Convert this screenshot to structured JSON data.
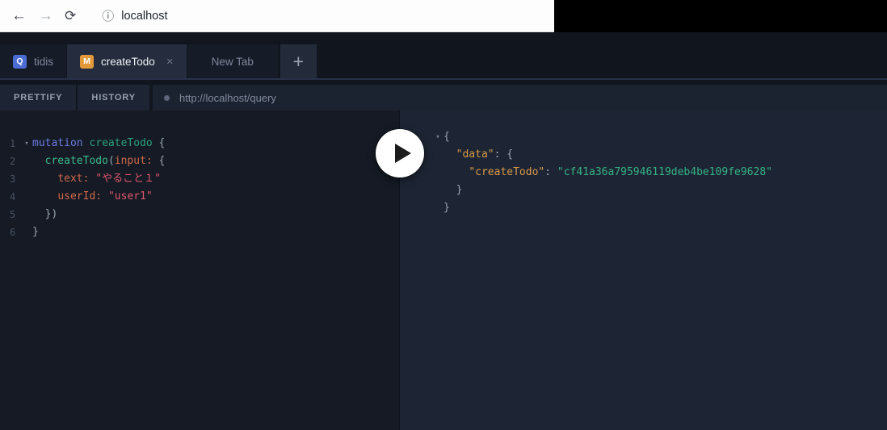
{
  "browser": {
    "address": "localhost"
  },
  "icons": {
    "back": "←",
    "forward": "→",
    "reload": "⟳",
    "info": "ⓘ",
    "close": "×",
    "add_tab": "+",
    "fold": "▾"
  },
  "tabs": {
    "items": [
      {
        "badge": "Q",
        "label": "tidis",
        "active": false
      },
      {
        "badge": "M",
        "label": "createTodo",
        "active": true
      },
      {
        "badge": "",
        "label": "New Tab",
        "active": false
      }
    ]
  },
  "toolbar": {
    "prettify_label": "PRETTIFY",
    "history_label": "HISTORY",
    "endpoint_url": "http://localhost/query"
  },
  "colors": {
    "query_badge": "#4a6cd4",
    "mutation_badge": "#e3993a",
    "kw": "#6b7be2",
    "def": "#2aa07c",
    "prop": "#3cbc8e",
    "attr": "#d0694b",
    "str": "#e0566e",
    "punc": "#9aa4b2",
    "key": "#dc9a47",
    "val": "#35b285"
  },
  "editor": {
    "lines": [
      {
        "num": "1",
        "fold": true,
        "tokens": [
          {
            "t": "mutation ",
            "c": "kw"
          },
          {
            "t": "createTodo",
            "c": "def"
          },
          {
            "t": " {",
            "c": "punc"
          }
        ]
      },
      {
        "num": "2",
        "tokens": [
          {
            "t": "  ",
            "c": "punc"
          },
          {
            "t": "createTodo",
            "c": "prop"
          },
          {
            "t": "(",
            "c": "punc"
          },
          {
            "t": "input:",
            "c": "attr"
          },
          {
            "t": " {",
            "c": "punc"
          }
        ]
      },
      {
        "num": "3",
        "tokens": [
          {
            "t": "    ",
            "c": "punc"
          },
          {
            "t": "text:",
            "c": "attr"
          },
          {
            "t": " ",
            "c": "punc"
          },
          {
            "t": "\"やること１\"",
            "c": "str"
          }
        ]
      },
      {
        "num": "4",
        "tokens": [
          {
            "t": "    ",
            "c": "punc"
          },
          {
            "t": "userId:",
            "c": "attr"
          },
          {
            "t": " ",
            "c": "punc"
          },
          {
            "t": "\"user1\"",
            "c": "str"
          }
        ]
      },
      {
        "num": "5",
        "tokens": [
          {
            "t": "  })",
            "c": "punc"
          }
        ]
      },
      {
        "num": "6",
        "tokens": [
          {
            "t": "}",
            "c": "punc"
          }
        ]
      }
    ]
  },
  "result": {
    "lines": [
      {
        "fold": true,
        "tokens": [
          {
            "t": "{",
            "c": "punc"
          }
        ]
      },
      {
        "tokens": [
          {
            "t": "  ",
            "c": "punc"
          },
          {
            "t": "\"data\"",
            "c": "key"
          },
          {
            "t": ": {",
            "c": "punc"
          }
        ]
      },
      {
        "tokens": [
          {
            "t": "    ",
            "c": "punc"
          },
          {
            "t": "\"createTodo\"",
            "c": "key"
          },
          {
            "t": ": ",
            "c": "punc"
          },
          {
            "t": "\"cf41a36a795946119deb4be109fe9628\"",
            "c": "val"
          }
        ]
      },
      {
        "tokens": [
          {
            "t": "  }",
            "c": "punc"
          }
        ]
      },
      {
        "tokens": [
          {
            "t": "}",
            "c": "punc"
          }
        ]
      }
    ]
  }
}
